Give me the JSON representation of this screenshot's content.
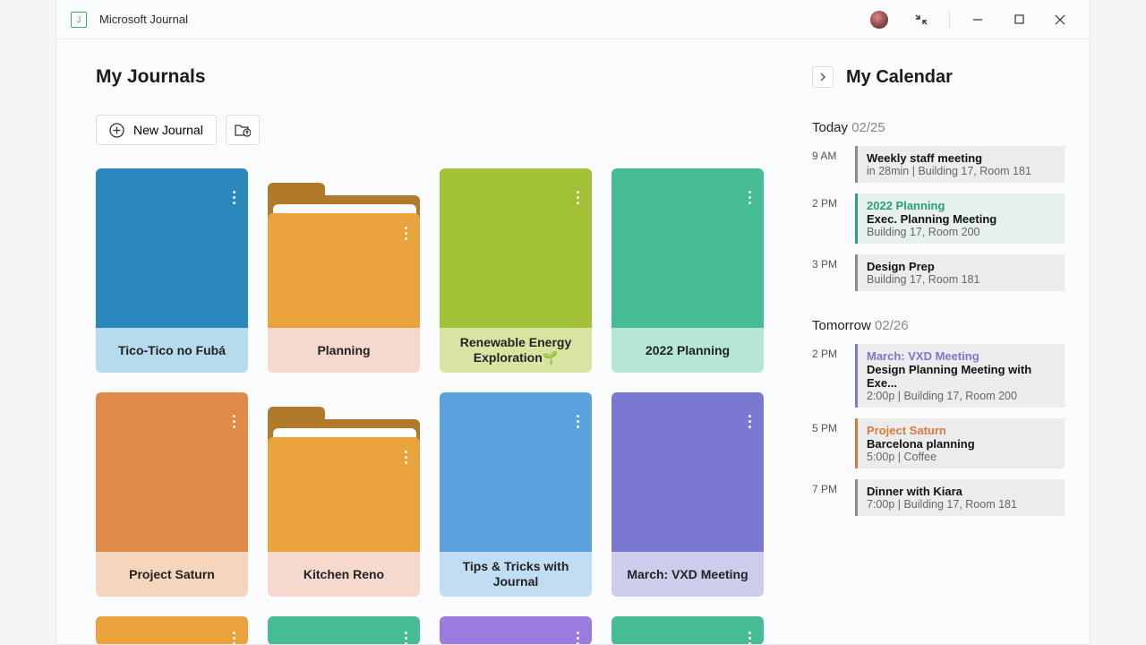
{
  "app": {
    "title": "Microsoft Journal"
  },
  "main": {
    "heading": "My Journals",
    "new_journal": "New Journal"
  },
  "journals": [
    {
      "title": "Tico-Tico no Fubá",
      "type": "card",
      "top": "#2b88bd",
      "bottom": "#b6daee"
    },
    {
      "title": "Planning",
      "type": "folder",
      "tab": "#b07a2a",
      "back": "#b07a2a",
      "front": "#eaa33c",
      "bottom": "#f7d8ce"
    },
    {
      "title": "Renewable Energy Exploration🌱",
      "type": "card",
      "top": "#a3c137",
      "bottom": "#d8e5a2"
    },
    {
      "title": "2022 Planning",
      "type": "card",
      "top": "#47bd96",
      "bottom": "#b6e7d5"
    },
    {
      "title": "Project Saturn",
      "type": "card",
      "top": "#e08a47",
      "bottom": "#f6d5bd"
    },
    {
      "title": "Kitchen Reno",
      "type": "folder",
      "tab": "#b07a2a",
      "back": "#b07a2a",
      "front": "#eaa33c",
      "bottom": "#f7d8ce"
    },
    {
      "title": "Tips & Tricks with Journal",
      "type": "card",
      "top": "#5aa2de",
      "bottom": "#c0ddf3"
    },
    {
      "title": "March: VXD Meeting",
      "type": "card",
      "top": "#7b78d1",
      "bottom": "#cdcced"
    },
    {
      "title": "",
      "type": "card",
      "top": "#eaa33c",
      "bottom": "#f6e0b8",
      "short": true
    },
    {
      "title": "",
      "type": "card",
      "top": "#47bd96",
      "bottom": "#b6e7d5",
      "short": true
    },
    {
      "title": "",
      "type": "card",
      "top": "#9c7be0",
      "bottom": "#dccaf4",
      "short": true
    },
    {
      "title": "",
      "type": "card",
      "top": "#47bd96",
      "bottom": "#b6e7d5",
      "short": true
    }
  ],
  "calendar": {
    "heading": "My Calendar",
    "days": [
      {
        "label": "Today",
        "date": "02/25",
        "events": [
          {
            "time": "9 AM",
            "accent": "#8a8a8a",
            "bg": "#ececec",
            "title": "Weekly staff meeting",
            "meta": "in 28min | Building 17, Room 181"
          },
          {
            "time": "2 PM",
            "accent": "#2aa07a",
            "bg": "#e6f1ee",
            "tag": "2022 Planning",
            "tagcolor": "#2aa07a",
            "title": "Exec. Planning Meeting",
            "meta": "Building 17, Room 200"
          },
          {
            "time": "3 PM",
            "accent": "#8a8a8a",
            "bg": "#ececec",
            "title": "Design Prep",
            "meta": "Building 17, Room 181"
          }
        ]
      },
      {
        "label": "Tomorrow",
        "date": "02/26",
        "events": [
          {
            "time": "2 PM",
            "accent": "#7b78d1",
            "bg": "#ececec",
            "tag": "March: VXD Meeting",
            "tagcolor": "#7b78d1",
            "title": "Design Planning Meeting with Exe...",
            "meta": "2:00p | Building 17, Room 200"
          },
          {
            "time": "5 PM",
            "accent": "#d67a3a",
            "bg": "#ececec",
            "tag": "Project Saturn",
            "tagcolor": "#d67a3a",
            "title": "Barcelona planning",
            "meta": "5:00p | Coffee"
          },
          {
            "time": "7 PM",
            "accent": "#8a8a8a",
            "bg": "#ececec",
            "title": "Dinner with Kiara",
            "meta": "7:00p | Building 17, Room 181"
          }
        ]
      }
    ]
  }
}
